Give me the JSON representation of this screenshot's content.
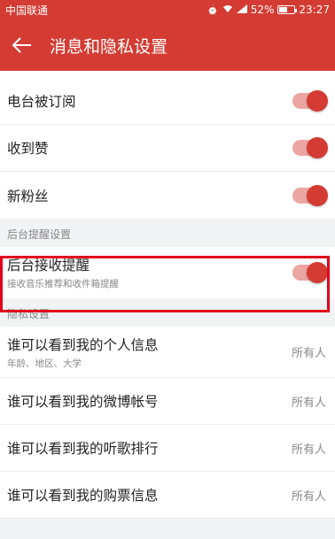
{
  "status_bar": {
    "carrier": "中国联通",
    "battery": "52%",
    "time": "23:27"
  },
  "header": {
    "title": "消息和隐私设置"
  },
  "notifications": [
    {
      "label": "电台被订阅",
      "enabled": true
    },
    {
      "label": "收到赞",
      "enabled": true
    },
    {
      "label": "新粉丝",
      "enabled": true
    }
  ],
  "background_section": {
    "title": "后台提醒设置",
    "item": {
      "label": "后台接收提醒",
      "sub": "接收音乐推荐和收件箱提醒",
      "enabled": true
    }
  },
  "privacy_section": {
    "title": "隐私设置",
    "items": [
      {
        "label": "谁可以看到我的个人信息",
        "sub": "年龄、地区、大学",
        "value": "所有人"
      },
      {
        "label": "谁可以看到我的微博帐号",
        "value": "所有人"
      },
      {
        "label": "谁可以看到我的听歌排行",
        "value": "所有人"
      },
      {
        "label": "谁可以看到我的购票信息",
        "value": "所有人"
      }
    ]
  },
  "colors": {
    "accent": "#d43c33",
    "highlight": "#e0001b"
  }
}
